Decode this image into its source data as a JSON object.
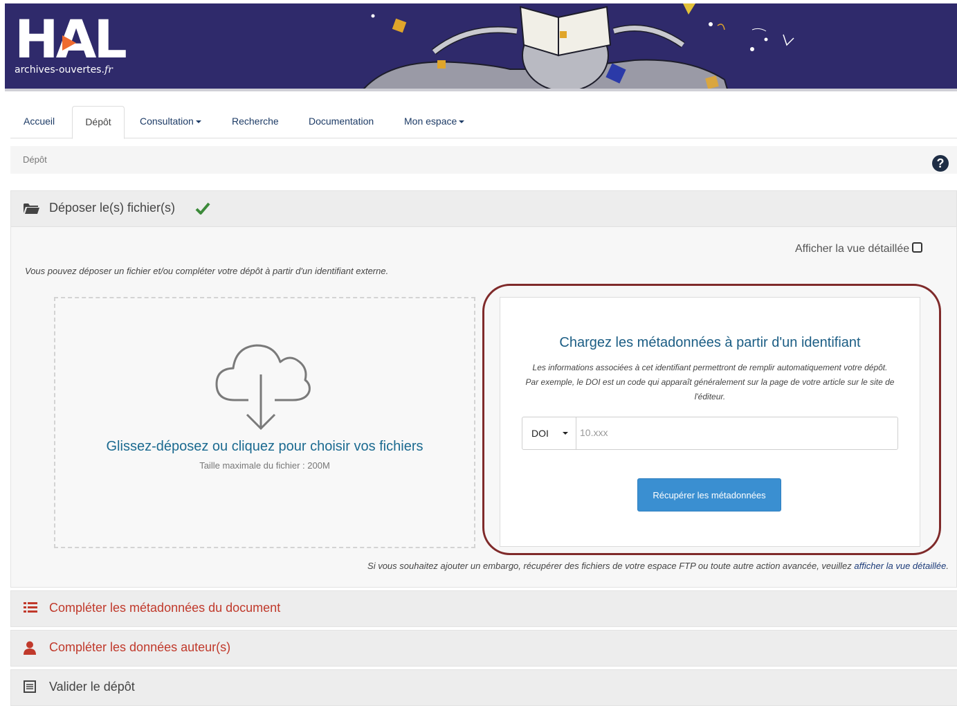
{
  "logo": {
    "text": "HAL",
    "subtitle_main": "archives-ouvertes.",
    "subtitle_tld": "fr"
  },
  "nav": {
    "tabs": [
      {
        "label": "Accueil",
        "dropdown": false
      },
      {
        "label": "Dépôt",
        "active": true,
        "dropdown": false
      },
      {
        "label": "Consultation",
        "dropdown": true
      },
      {
        "label": "Recherche",
        "dropdown": false
      },
      {
        "label": "Documentation",
        "dropdown": false
      },
      {
        "label": "Mon espace",
        "dropdown": true
      }
    ]
  },
  "breadcrumb": {
    "current": "Dépôt"
  },
  "help_icon": "question-circle-icon",
  "deposit_panel": {
    "title": "Déposer le(s) fichier(s)",
    "status_icon": "check-icon",
    "detail_toggle_label": "Afficher la vue détaillée",
    "intro": "Vous pouvez déposer un fichier et/ou compléter votre dépôt à partir d'un identifiant externe.",
    "dropzone": {
      "main_text": "Glissez-déposez ou cliquez pour choisir vos fichiers",
      "sub_text": "Taille maximale du fichier : 200M"
    },
    "identifier_box": {
      "title": "Chargez les métadonnées à partir d'un identifiant",
      "description": "Les informations associées à cet identifiant permettront de remplir automatiquement votre dépôt. Par exemple, le DOI est un code qui apparaît généralement sur la page de votre article sur le site de l'éditeur.",
      "select_value": "DOI",
      "input_placeholder": "10.xxx",
      "input_value": "",
      "button_label": "Récupérer les métadonnées"
    },
    "footnote_text": "Si vous souhaitez ajouter un embargo, récupérer des fichiers de votre espace FTP ou toute autre action avancée, veuillez ",
    "footnote_link": "afficher la vue détaillée",
    "footnote_end": "."
  },
  "sections": [
    {
      "label": "Compléter les métadonnées du document",
      "icon": "list-icon",
      "color": "#c0392b"
    },
    {
      "label": "Compléter les données auteur(s)",
      "icon": "user-icon",
      "color": "#c0392b"
    },
    {
      "label": "Valider le dépôt",
      "icon": "document-list-icon",
      "color": "#444444"
    }
  ],
  "colors": {
    "banner": "#2f2a6b",
    "accent_orange": "#ef6b30",
    "primary_button": "#3a8fd1",
    "link_blue": "#1b6a90",
    "section_red": "#c0392b",
    "success_green": "#3c8a3a",
    "highlight_annotation": "#7f2a2a"
  }
}
